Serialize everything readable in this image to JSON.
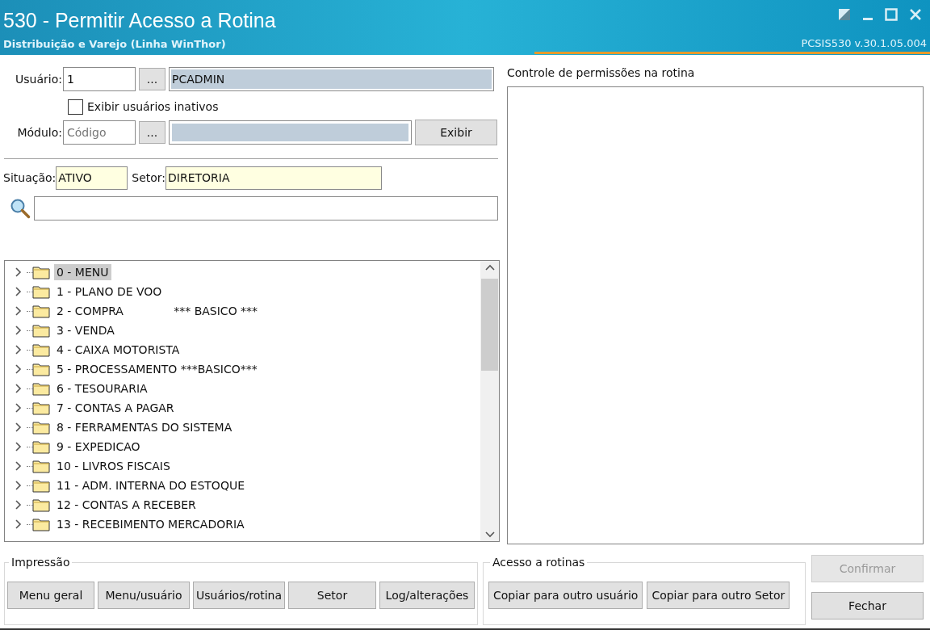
{
  "window": {
    "title": "530 - Permitir Acesso a Rotina",
    "subtitle": "Distribuição e Varejo (Linha WinThor)",
    "version": "PCSIS530  v.30.1.05.004"
  },
  "form": {
    "user": {
      "label": "Usuário:",
      "code": "1",
      "browse": "...",
      "name": "PCADMIN"
    },
    "show_inactive": {
      "label": "Exibir usuários inativos",
      "checked": false
    },
    "module": {
      "label": "Módulo:",
      "placeholder": "Código",
      "browse": "...",
      "show_button": "Exibir"
    },
    "status": {
      "label": "Situação:",
      "value": "ATIVO"
    },
    "sector": {
      "label": "Setor:",
      "value": "DIRETORIA"
    }
  },
  "tree": [
    {
      "label": "0 - MENU",
      "selected": true
    },
    {
      "label": "1 - PLANO DE VOO",
      "selected": false
    },
    {
      "label": "2 - COMPRA              *** BASICO ***",
      "selected": false
    },
    {
      "label": "3 - VENDA",
      "selected": false
    },
    {
      "label": "4 - CAIXA MOTORISTA",
      "selected": false
    },
    {
      "label": "5 - PROCESSAMENTO ***BASICO***",
      "selected": false
    },
    {
      "label": "6 - TESOURARIA",
      "selected": false
    },
    {
      "label": "7 - CONTAS A PAGAR",
      "selected": false
    },
    {
      "label": "8 - FERRAMENTAS DO SISTEMA",
      "selected": false
    },
    {
      "label": "9 - EXPEDICAO",
      "selected": false
    },
    {
      "label": "10 - LIVROS FISCAIS",
      "selected": false
    },
    {
      "label": "11 - ADM. INTERNA DO ESTOQUE",
      "selected": false
    },
    {
      "label": "12 - CONTAS A RECEBER",
      "selected": false
    },
    {
      "label": "13 - RECEBIMENTO MERCADORIA",
      "selected": false
    }
  ],
  "permissions": {
    "title": "Controle de permissões na rotina"
  },
  "printing": {
    "title": "Impressão",
    "buttons": [
      "Menu geral",
      "Menu/usuário",
      "Usuários/rotina",
      "Setor",
      "Log/alterações"
    ]
  },
  "access": {
    "title": "Acesso a rotinas",
    "buttons": [
      "Copiar para outro usuário",
      "Copiar para outro Setor"
    ]
  },
  "actions": [
    {
      "label": "Confirmar",
      "disabled": true
    },
    {
      "label": "Fechar",
      "disabled": false
    }
  ]
}
